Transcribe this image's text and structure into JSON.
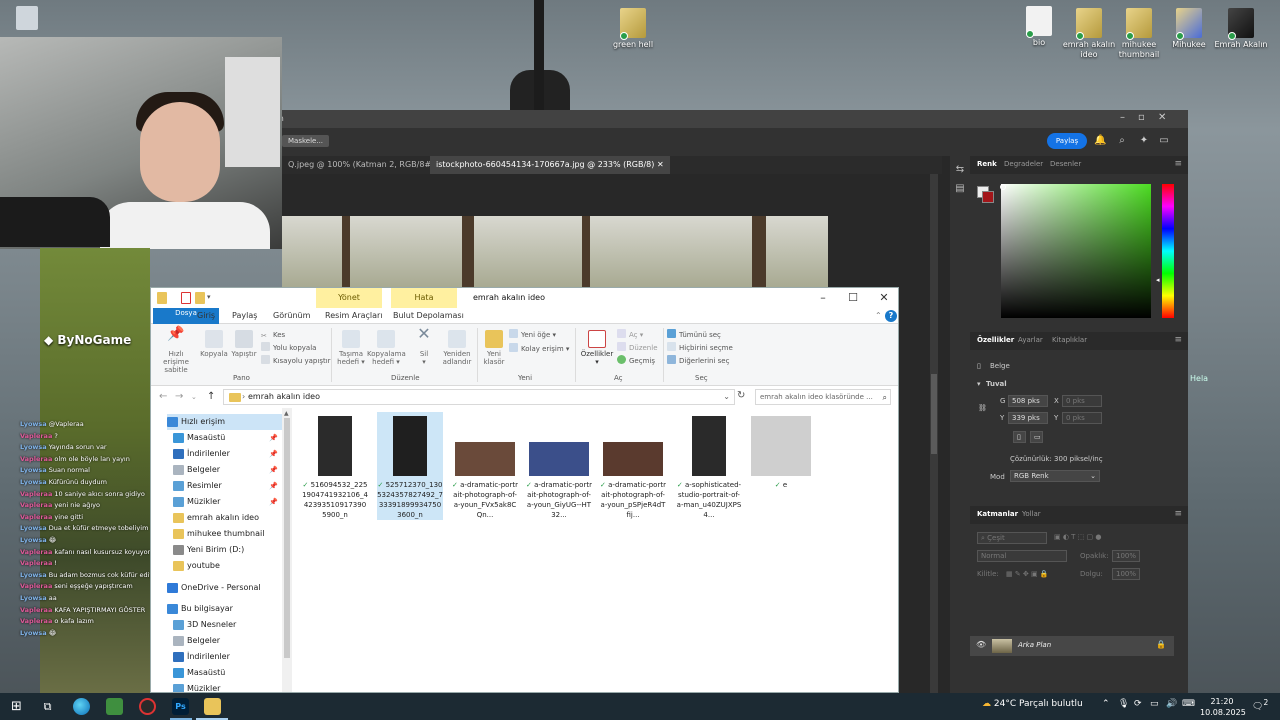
{
  "desktop": {
    "icons": [
      {
        "label": "green hell"
      },
      {
        "label": "bio"
      },
      {
        "label": "emrah akalın ideo"
      },
      {
        "label": "mihukee thumbnail"
      },
      {
        "label": "Mihukee"
      },
      {
        "label": "Emrah Akalın"
      }
    ]
  },
  "photoshop": {
    "title_fragment": "m",
    "options_chip": "Maskele...",
    "share_label": "Paylaş",
    "tabs": [
      {
        "label": "Q.jpeg @ 100% (Katman 2, RGB/8#) *"
      },
      {
        "label": "istockphoto-660454134-170667a.jpg @ 233% (RGB/8)"
      }
    ],
    "color_panel": {
      "tabs": [
        "Renk",
        "Degradeler",
        "Desenler"
      ],
      "fg_color": "#eeeeee",
      "bg_color": "#a3161a",
      "hue_color": "#4cdc22"
    },
    "properties_panel": {
      "tabs": [
        "Özellikler",
        "Ayarlar",
        "Kitaplıklar"
      ],
      "doc_label": "Belge",
      "section": "Tuval",
      "w_label": "G",
      "w_value": "508 pks",
      "h_label": "Y",
      "h_value": "339 pks",
      "x_label": "X",
      "x_placeholder": "0 pks",
      "y_label": "Y",
      "y_placeholder": "0 pks",
      "resolution": "Çözünürlük: 300 piksel/inç",
      "mode_label": "Mod",
      "mode_value": "RGB Renk"
    },
    "layers_panel": {
      "tabs": [
        "Katmanlar",
        "Yollar"
      ],
      "filter_placeholder": "Çeşit",
      "blend_mode": "Normal",
      "opacity_label": "Opaklık:",
      "opacity_value": "100%",
      "lock_label": "Kilitle:",
      "fill_label": "Dolgu:",
      "fill_value": "100%",
      "layer_name": "Arka Plan"
    },
    "overflow_label": "Hela"
  },
  "stream": {
    "logo_text": "ByNoGame",
    "chat": [
      {
        "user": "Lyowsa",
        "msg": "@Vapleraa",
        "color": "#7fb2e8"
      },
      {
        "user": "Vapleraa",
        "msg": "?",
        "color": "#e05a9a"
      },
      {
        "user": "Lyowsa",
        "msg": "Yayında sorun var",
        "color": "#7fb2e8"
      },
      {
        "user": "Vapleraa",
        "msg": "olm ole böyle lan yayın",
        "color": "#e05a9a"
      },
      {
        "user": "Lyowsa",
        "msg": "Suan normal",
        "color": "#7fb2e8"
      },
      {
        "user": "Lyowsa",
        "msg": "Küfürünü duydum",
        "color": "#7fb2e8"
      },
      {
        "user": "Vapleraa",
        "msg": "10 saniye akıcı sonra gidiyo",
        "color": "#e05a9a"
      },
      {
        "user": "Vapleraa",
        "msg": "yeni nie ağıyo",
        "color": "#e05a9a"
      },
      {
        "user": "Vapleraa",
        "msg": "yine gitti",
        "color": "#e05a9a"
      },
      {
        "user": "Lyowsa",
        "msg": "Dua et küfür etmeye tobeliyim",
        "color": "#7fb2e8"
      },
      {
        "user": "Lyowsa",
        "msg": "😂",
        "color": "#7fb2e8"
      },
      {
        "user": "Vapleraa",
        "msg": "kafanı nasıl kusursuz koyuyorsun",
        "color": "#e05a9a"
      },
      {
        "user": "Vapleraa",
        "msg": "!",
        "color": "#e05a9a"
      },
      {
        "user": "Lyowsa",
        "msg": "Bu adam bozmus cok küfür ediyo",
        "color": "#7fb2e8"
      },
      {
        "user": "Vapleraa",
        "msg": "seni eşşeğe yapıştırcam",
        "color": "#e05a9a"
      },
      {
        "user": "Lyowsa",
        "msg": "aa",
        "color": "#7fb2e8"
      },
      {
        "user": "Vapleraa",
        "msg": "KAFA YAPIŞTIRMAYI GÖSTER",
        "color": "#e05a9a"
      },
      {
        "user": "Vapleraa",
        "msg": "o kafa lazım",
        "color": "#e05a9a"
      },
      {
        "user": "Lyowsa",
        "msg": "😂",
        "color": "#7fb2e8"
      }
    ]
  },
  "explorer": {
    "context_tabs": [
      "Yönet",
      "Hata"
    ],
    "title": "emrah akalın ideo",
    "menu_tabs": [
      "Dosya",
      "Giriş",
      "Paylaş",
      "Görünüm",
      "Resim Araçları",
      "Bulut Depolaması"
    ],
    "ribbon": {
      "pano": {
        "pin": "Hızlı erişime sabitle",
        "copy": "Kopyala",
        "paste": "Yapıştır",
        "cut": "Kes",
        "copy_path": "Yolu kopyala",
        "paste_shortcut": "Kısayolu yapıştır",
        "group": "Pano"
      },
      "duzenle": {
        "move": "Taşıma hedefi",
        "copy_to": "Kopyalama hedefi",
        "delete": "Sil",
        "rename": "Yeniden adlandır",
        "group": "Düzenle"
      },
      "yeni": {
        "new_folder": "Yeni klasör",
        "new_item": "Yeni öğe",
        "easy_access": "Kolay erişim",
        "group": "Yeni"
      },
      "ac": {
        "properties": "Özellikler",
        "open": "Aç",
        "edit": "Düzenle",
        "history": "Geçmiş",
        "group": "Aç"
      },
      "sec": {
        "select_all": "Tümünü seç",
        "select_none": "Hiçbirini seçme",
        "invert": "Diğerlerini seç",
        "group": "Seç"
      }
    },
    "address": "emrah akalın ideo",
    "search_placeholder": "emrah akalın ideo klasöründe ...",
    "tree": [
      {
        "label": "Hızlı erişim",
        "color": "#3a88d8",
        "pinned": false,
        "selected": true
      },
      {
        "label": "Masaüstü",
        "color": "#3a96d8",
        "pinned": true,
        "selected": false
      },
      {
        "label": "İndirilenler",
        "color": "#2f6fbd",
        "pinned": true,
        "selected": false
      },
      {
        "label": "Belgeler",
        "color": "#aab4bf",
        "pinned": true,
        "selected": false
      },
      {
        "label": "Resimler",
        "color": "#5aa0d6",
        "pinned": true,
        "selected": false
      },
      {
        "label": "Müzikler",
        "color": "#5aa0d6",
        "pinned": true,
        "selected": false
      },
      {
        "label": "emrah akalın ideo",
        "color": "#e9c45a",
        "pinned": false,
        "selected": false
      },
      {
        "label": "mihukee thumbnail",
        "color": "#e9c45a",
        "pinned": false,
        "selected": false
      },
      {
        "label": "Yeni Birim (D:)",
        "color": "#8a8a8a",
        "pinned": false,
        "selected": false
      },
      {
        "label": "youtube",
        "color": "#e9c45a",
        "pinned": false,
        "selected": false
      },
      {
        "label": "OneDrive - Personal",
        "color": "#2f7ad8",
        "pinned": false,
        "selected": false
      },
      {
        "label": "Bu bilgisayar",
        "color": "#3a88d8",
        "pinned": false,
        "selected": false
      },
      {
        "label": "3D Nesneler",
        "color": "#5aa0d6",
        "pinned": false,
        "selected": false
      },
      {
        "label": "Belgeler",
        "color": "#aab4bf",
        "pinned": false,
        "selected": false
      },
      {
        "label": "İndirilenler",
        "color": "#2f6fbd",
        "pinned": false,
        "selected": false
      },
      {
        "label": "Masaüstü",
        "color": "#3a96d8",
        "pinned": false,
        "selected": false
      },
      {
        "label": "Müzikler",
        "color": "#5aa0d6",
        "pinned": false,
        "selected": false
      }
    ],
    "files": [
      {
        "name": "516094532_2251904741932106_4423935109173905900_n",
        "orientation": "portrait"
      },
      {
        "name": "525712370_1305324357827492_7333918999347503600_n",
        "orientation": "portrait",
        "selected": true
      },
      {
        "name": "a-dramatic-portrait-photograph-of-a-youn_FVx5ak8CQn...",
        "orientation": "landscape"
      },
      {
        "name": "a-dramatic-portrait-photograph-of-a-youn_GiyUG--HT32...",
        "orientation": "landscape"
      },
      {
        "name": "a-dramatic-portrait-photograph-of-a-youn_pSPjeR4dTfij...",
        "orientation": "landscape"
      },
      {
        "name": "a-sophisticated-studio-portrait-of-a-man_u40ZUJXPS4...",
        "orientation": "portrait"
      },
      {
        "name": "e",
        "orientation": "square"
      }
    ]
  },
  "taskbar": {
    "weather": "24°C  Parçalı bulutlu",
    "time": "21:20",
    "date": "10.08.2025",
    "notif_count": "2"
  }
}
